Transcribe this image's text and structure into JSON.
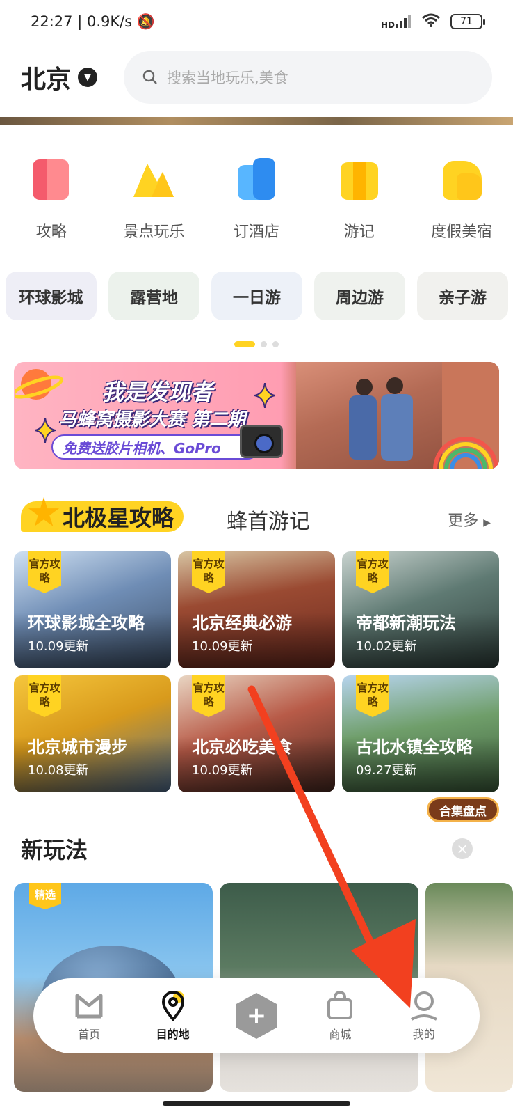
{
  "status_bar": {
    "time": "22:27",
    "speed": "0.9K/s",
    "signal": "HD",
    "battery": "71"
  },
  "header": {
    "city": "北京",
    "search_placeholder": "搜索当地玩乐,美食"
  },
  "categories": [
    {
      "label": "攻略",
      "icon": "guide-icon",
      "color": "#f45b6c"
    },
    {
      "label": "景点玩乐",
      "icon": "attraction-icon",
      "color": "#ffd322"
    },
    {
      "label": "订酒店",
      "icon": "hotel-icon",
      "color": "#3aa0ff"
    },
    {
      "label": "游记",
      "icon": "travelogue-icon",
      "color": "#ffc61a"
    },
    {
      "label": "度假美宿",
      "icon": "vacation-icon",
      "color": "#ffc61a"
    }
  ],
  "chips": [
    {
      "label": "环球影城",
      "bg": "#eeeef6"
    },
    {
      "label": "露营地",
      "bg": "#ecf2ec"
    },
    {
      "label": "一日游",
      "bg": "#edf1f8"
    },
    {
      "label": "周边游",
      "bg": "#eff2ee"
    },
    {
      "label": "亲子游",
      "bg": "#f1f1ee"
    }
  ],
  "banner": {
    "title": "我是发现者",
    "subtitle": "马蜂窝摄影大赛 第二期",
    "tagline": "免费送胶片相机、GoPro"
  },
  "polar_section": {
    "active_tab": "北极星攻略",
    "other_tab": "蜂首游记",
    "more": "更多",
    "badge": "官方攻略",
    "cards": [
      {
        "title": "环球影城全攻略",
        "date": "10.09更新",
        "bg": "linear-gradient(160deg,#cfe0f2,#6f8db5 45%,#3d4f66)"
      },
      {
        "title": "北京经典必游",
        "date": "10.09更新",
        "bg": "linear-gradient(170deg,#d7c4a2,#9a4a32 40%,#6b2a1f)"
      },
      {
        "title": "帝都新潮玩法",
        "date": "10.02更新",
        "bg": "linear-gradient(160deg,#c9d3cf,#5f7a73 45%,#2f3f3b)"
      },
      {
        "title": "北京城市漫步",
        "date": "10.08更新",
        "bg": "linear-gradient(160deg,#f5c63c,#d89a1c 45%,#4e6c8f)"
      },
      {
        "title": "北京必吃美食",
        "date": "10.09更新",
        "bg": "linear-gradient(160deg,#e9d6c3,#b85b48 45%,#4a2a22)"
      },
      {
        "title": "古北水镇全攻略",
        "date": "09.27更新",
        "bg": "linear-gradient(170deg,#b7d4ee,#6f9e6a 45%,#3d5e3c)"
      }
    ],
    "collect": "合集盘点"
  },
  "new_section": {
    "title": "新玩法",
    "pick_badge": "精选"
  },
  "nav": [
    {
      "label": "首页",
      "icon": "home-icon"
    },
    {
      "label": "目的地",
      "icon": "destination-icon",
      "active": true
    },
    {
      "label": "",
      "icon": "plus-icon"
    },
    {
      "label": "商城",
      "icon": "shop-icon"
    },
    {
      "label": "我的",
      "icon": "profile-icon"
    }
  ]
}
